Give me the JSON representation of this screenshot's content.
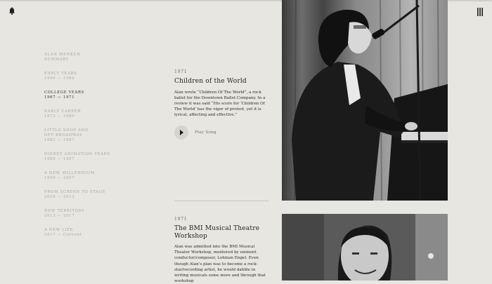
{
  "nav": [
    {
      "title": "Alan Menken",
      "subtitle": "Summary"
    },
    {
      "title": "Early Years",
      "years": "1949 — 1966"
    },
    {
      "title": "College Years",
      "years": "1967 — 1971",
      "active": true
    },
    {
      "title": "Early Career",
      "years": "1972 — 1980"
    },
    {
      "title": "Little Shop and Off-Broadway",
      "years": "1982 — 1987"
    },
    {
      "title": "Disney Animation Years",
      "years": "1989 — 1997"
    },
    {
      "title": "A New Millennium",
      "years": "1999 — 2007"
    },
    {
      "title": "From Screen to Stage",
      "years": "2008 — 2013"
    },
    {
      "title": "New Territory",
      "years": "2013 — 2017"
    },
    {
      "title": "A New Life",
      "years": "2017 — Current"
    }
  ],
  "entries": [
    {
      "year": "1971",
      "title": "Children of the World",
      "body": "Alan wrote “Children Of The World”, a rock ballet for the Downtown Ballet Company. In a review it was said “His score for ‘Children Of The World’ has the vigor of protest, yet it is lyrical, affecting and effective.”",
      "play_label": "Play Song"
    },
    {
      "year": "1971",
      "title": "The BMI Musical Theatre Workshop",
      "body": "Alan was admitted into the BMI Musical Theater Workshop, mentored by eminent conductor/composer, Lehman Engel. Even though Alan’s plan was to become a rock-star/recording artist, he would dabble in writing musicals some more and through that workshop"
    }
  ],
  "icons": {
    "bell": "bell-icon",
    "menu": "menu-icon",
    "play": "play-icon"
  },
  "colors": {
    "background": "#e8e6e1",
    "text": "#2a2a2a",
    "muted": "#a8a6a1",
    "play_button": "#d6d4ce"
  }
}
